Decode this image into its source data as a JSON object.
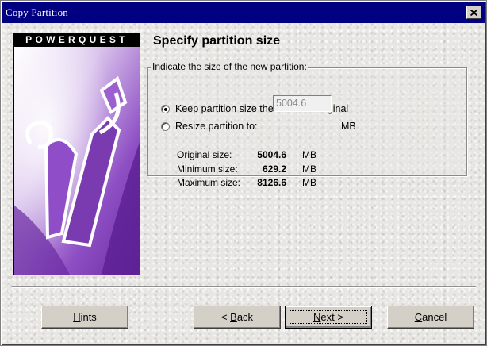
{
  "window": {
    "title": "Copy Partition"
  },
  "logo": {
    "brand": "POWERQUEST"
  },
  "heading": "Specify partition size",
  "group": {
    "legend": "Indicate the size of the new partition:",
    "option_keep": "Keep partition size the same as original",
    "option_resize": "Resize partition to:",
    "resize_value": "5004.6",
    "resize_unit": "MB",
    "selected": "keep"
  },
  "stats": [
    {
      "label": "Original size:",
      "value": "5004.6",
      "unit": "MB"
    },
    {
      "label": "Minimum size:",
      "value": "629.2",
      "unit": "MB"
    },
    {
      "label": "Maximum size:",
      "value": "8126.6",
      "unit": "MB"
    }
  ],
  "buttons": {
    "hints": {
      "pre": "",
      "key": "H",
      "post": "ints"
    },
    "back": {
      "pre": "< ",
      "key": "B",
      "post": "ack"
    },
    "next": {
      "pre": "",
      "key": "N",
      "post": "ext >"
    },
    "cancel": {
      "pre": "",
      "key": "C",
      "post": "ancel"
    }
  },
  "colors": {
    "titlebar": "#000080",
    "logo_purple": "#7a3bb0"
  },
  "icons": {
    "close": "close-icon",
    "logo_art": "powerquest-logo-art"
  }
}
